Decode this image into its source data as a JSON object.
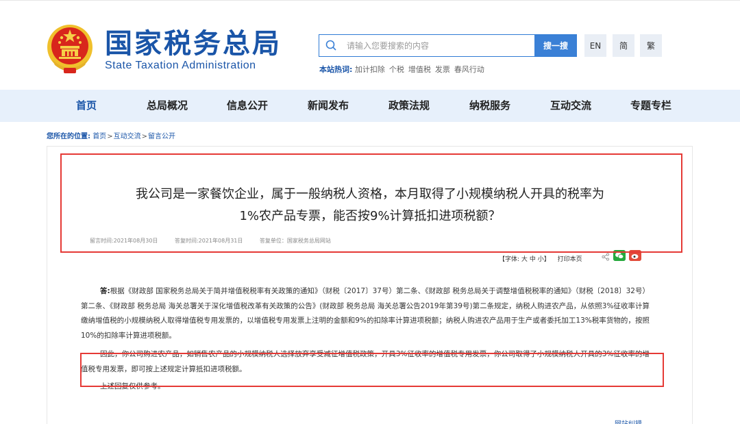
{
  "header": {
    "logo_cn": "国家税务总局",
    "logo_en": "State Taxation Administration"
  },
  "search": {
    "placeholder": "请输入您要搜索的内容",
    "button": "搜一搜"
  },
  "languages": [
    "EN",
    "简",
    "繁"
  ],
  "hot": {
    "label": "本站热词:",
    "keywords": [
      "加计扣除",
      "个税",
      "增值税",
      "发票",
      "春风行动"
    ]
  },
  "nav": [
    "首页",
    "总局概况",
    "信息公开",
    "新闻发布",
    "政策法规",
    "纳税服务",
    "互动交流",
    "专题专栏"
  ],
  "breadcrumb": {
    "label": "您所在的位置:",
    "items": [
      "首页",
      "互动交流",
      "留言公开"
    ],
    "sep": ">"
  },
  "question": {
    "line1": "我公司是一家餐饮企业，属于一般纳税人资格，本月取得了小规模纳税人开具的税率为",
    "line2": "1%农产品专票，能否按9%计算抵扣进项税额？",
    "msg_time": "留言时间:2021年08月30日",
    "reply_time": "答复时间:2021年08月31日",
    "unit": "答复单位：国家税务总局网站"
  },
  "tools": {
    "font_label": "【字体:",
    "sizes": [
      "大",
      "中",
      "小"
    ],
    "font_close": "】",
    "print": "打印本页"
  },
  "answer": {
    "lead": "答:",
    "p1": "根据《财政部 国家税务总局关于简并增值税税率有关政策的通知》（财税〔2017〕37号）第二条、《财政部 税务总局关于调整增值税税率的通知》（财税〔2018〕32号）第二条、《财政部 税务总局 海关总署关于深化增值税改革有关政策的公告》(财政部 税务总局 海关总署公告2019年第39号)第二条规定，纳税人购进农产品，从依照3%征收率计算缴纳增值税的小规模纳税人取得增值税专用发票的，以增值税专用发票上注明的金额和9%的扣除率计算进项税额；纳税人购进农产品用于生产或者委托加工13%税率货物的，按照10%的扣除率计算进项税额。",
    "p2": "因此，你公司购进农产品，如销售农产品的小规模纳税人选择放弃享受减征增值税政策，开具3%征收率的增值税专用发票，你公司取得了小规模纳税人开具的3%征收率的增值税专用发票，即可按上述规定计算抵扣进项税额。",
    "p3": "上述回复仅供参考。"
  },
  "footer_link": "网站纠错",
  "colors": {
    "brand": "#1a55a8",
    "nav_bg": "#e7f0fb",
    "highlight": "#e53935"
  }
}
